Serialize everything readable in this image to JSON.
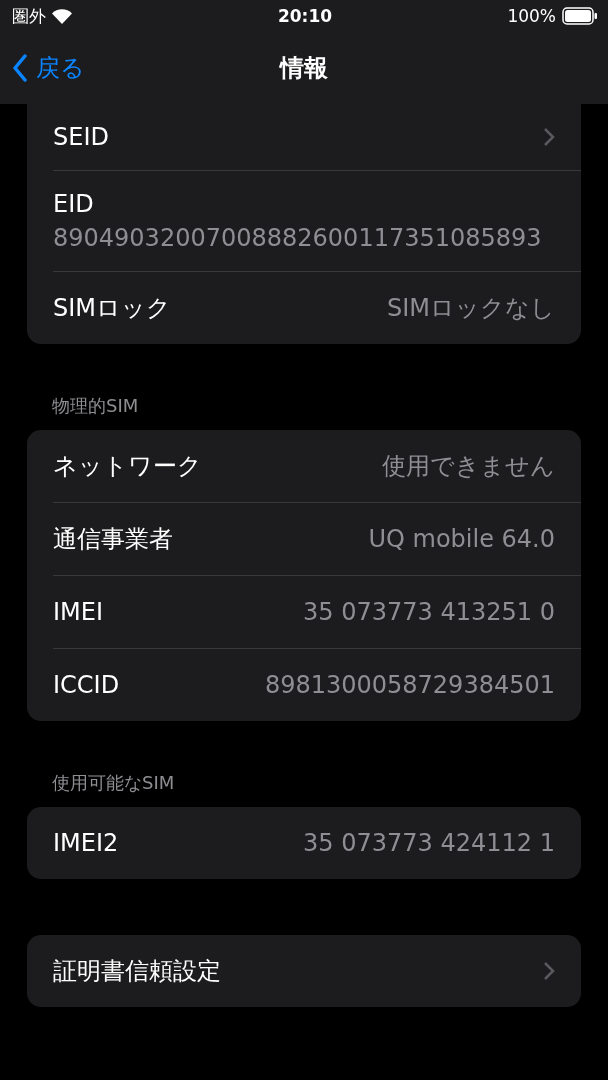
{
  "status_bar": {
    "carrier": "圏外",
    "time": "20:10",
    "battery": "100%"
  },
  "nav": {
    "back": "戻る",
    "title": "情報"
  },
  "sections": [
    {
      "rows": [
        {
          "kind": "chevron",
          "label": "SEID"
        },
        {
          "kind": "stacked",
          "label": "EID",
          "value": "89049032007008882600117351085893"
        },
        {
          "kind": "value",
          "label": "SIMロック",
          "value": "SIMロックなし"
        }
      ]
    },
    {
      "header": "物理的SIM",
      "rows": [
        {
          "kind": "value",
          "label": "ネットワーク",
          "value": "使用できません"
        },
        {
          "kind": "value",
          "label": "通信事業者",
          "value": "UQ mobile 64.0"
        },
        {
          "kind": "value",
          "label": "IMEI",
          "value": "35 073773 413251 0"
        },
        {
          "kind": "value",
          "label": "ICCID",
          "value": "8981300058729384501"
        }
      ]
    },
    {
      "header": "使用可能なSIM",
      "rows": [
        {
          "kind": "value",
          "label": "IMEI2",
          "value": "35 073773 424112 1"
        }
      ]
    },
    {
      "rows": [
        {
          "kind": "chevron",
          "label": "証明書信頼設定"
        }
      ]
    }
  ]
}
